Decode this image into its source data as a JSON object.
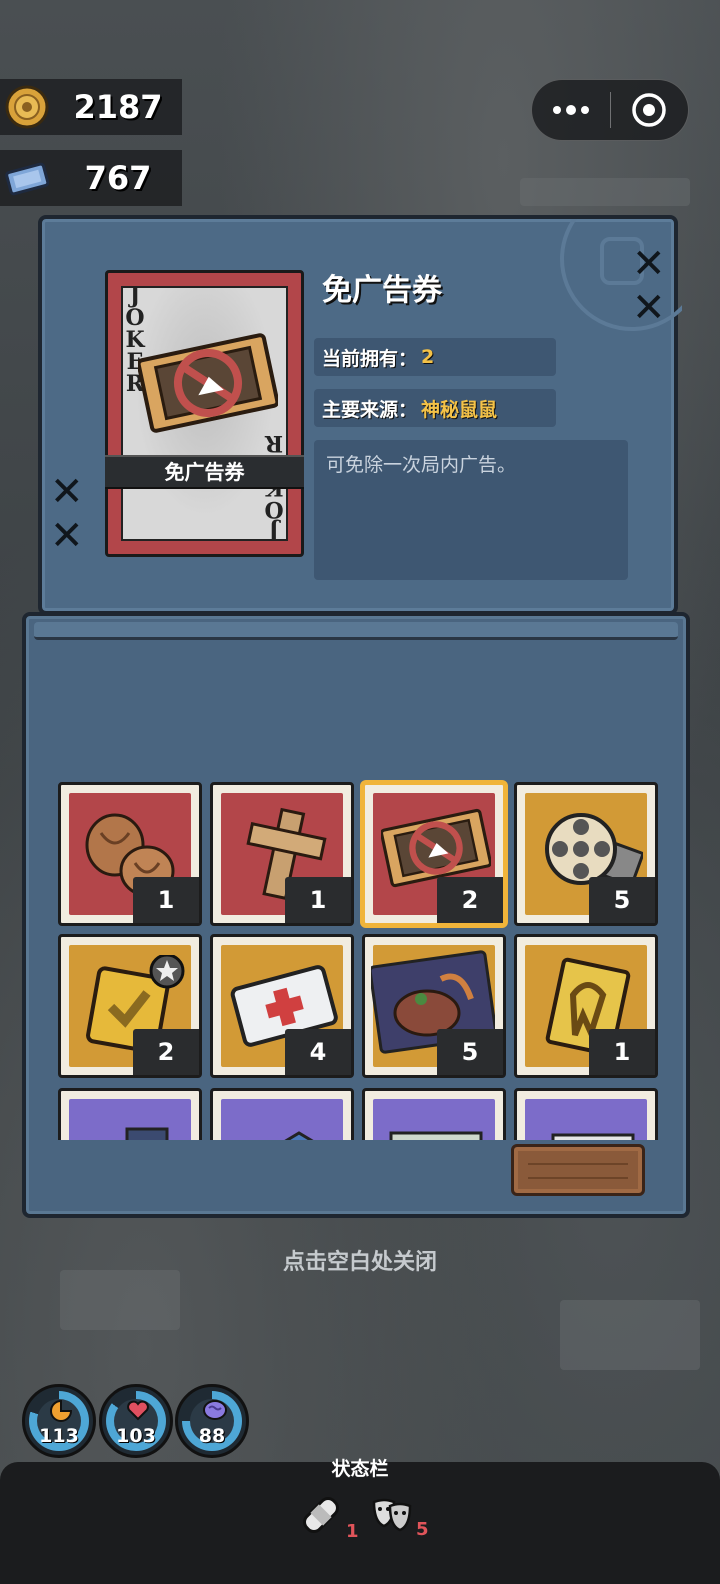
{
  "currency": {
    "coins": "2187",
    "tickets": "767"
  },
  "capsule": {
    "more_icon": "more-dots-icon",
    "close_icon": "target-close-icon"
  },
  "detail": {
    "card_joker_text": "JOKER",
    "card_label": "免广告券",
    "title": "免广告券",
    "owned_label": "当前拥有：",
    "owned_value": "2",
    "source_label": "主要来源：",
    "source_value": "神秘鼠鼠",
    "description": "可免除一次局内广告。"
  },
  "inventory": {
    "items": [
      {
        "name": "walnuts",
        "color": "red",
        "count": "1"
      },
      {
        "name": "wooden-cross",
        "color": "red",
        "count": "1"
      },
      {
        "name": "no-ad-ticket",
        "color": "red",
        "count": "2",
        "selected": true
      },
      {
        "name": "film-reel",
        "color": "gold",
        "count": "5"
      },
      {
        "name": "gold-badge",
        "color": "gold",
        "count": "2"
      },
      {
        "name": "medical-card",
        "color": "gold",
        "count": "4"
      },
      {
        "name": "steak-package",
        "color": "gold",
        "count": "5"
      },
      {
        "name": "gold-ribbon-card",
        "color": "gold",
        "count": "1"
      },
      {
        "name": "purple-item-1",
        "color": "purple",
        "count": ""
      },
      {
        "name": "purple-item-2",
        "color": "purple",
        "count": ""
      },
      {
        "name": "purple-item-3",
        "color": "purple",
        "count": ""
      },
      {
        "name": "purple-item-4",
        "color": "purple",
        "count": ""
      }
    ]
  },
  "close_hint": "点击空白处关闭",
  "stats": {
    "hunger": "113",
    "health": "103",
    "sanity": "88"
  },
  "statusbar": {
    "title": "状态栏",
    "bandage_count": "1",
    "mask_count": "5"
  },
  "colors": {
    "panel": "#4d6a86",
    "card_red": "#b3464a",
    "slot_gold": "#d29a36",
    "slot_purple": "#7c6cc9",
    "highlight": "#f4c247"
  }
}
